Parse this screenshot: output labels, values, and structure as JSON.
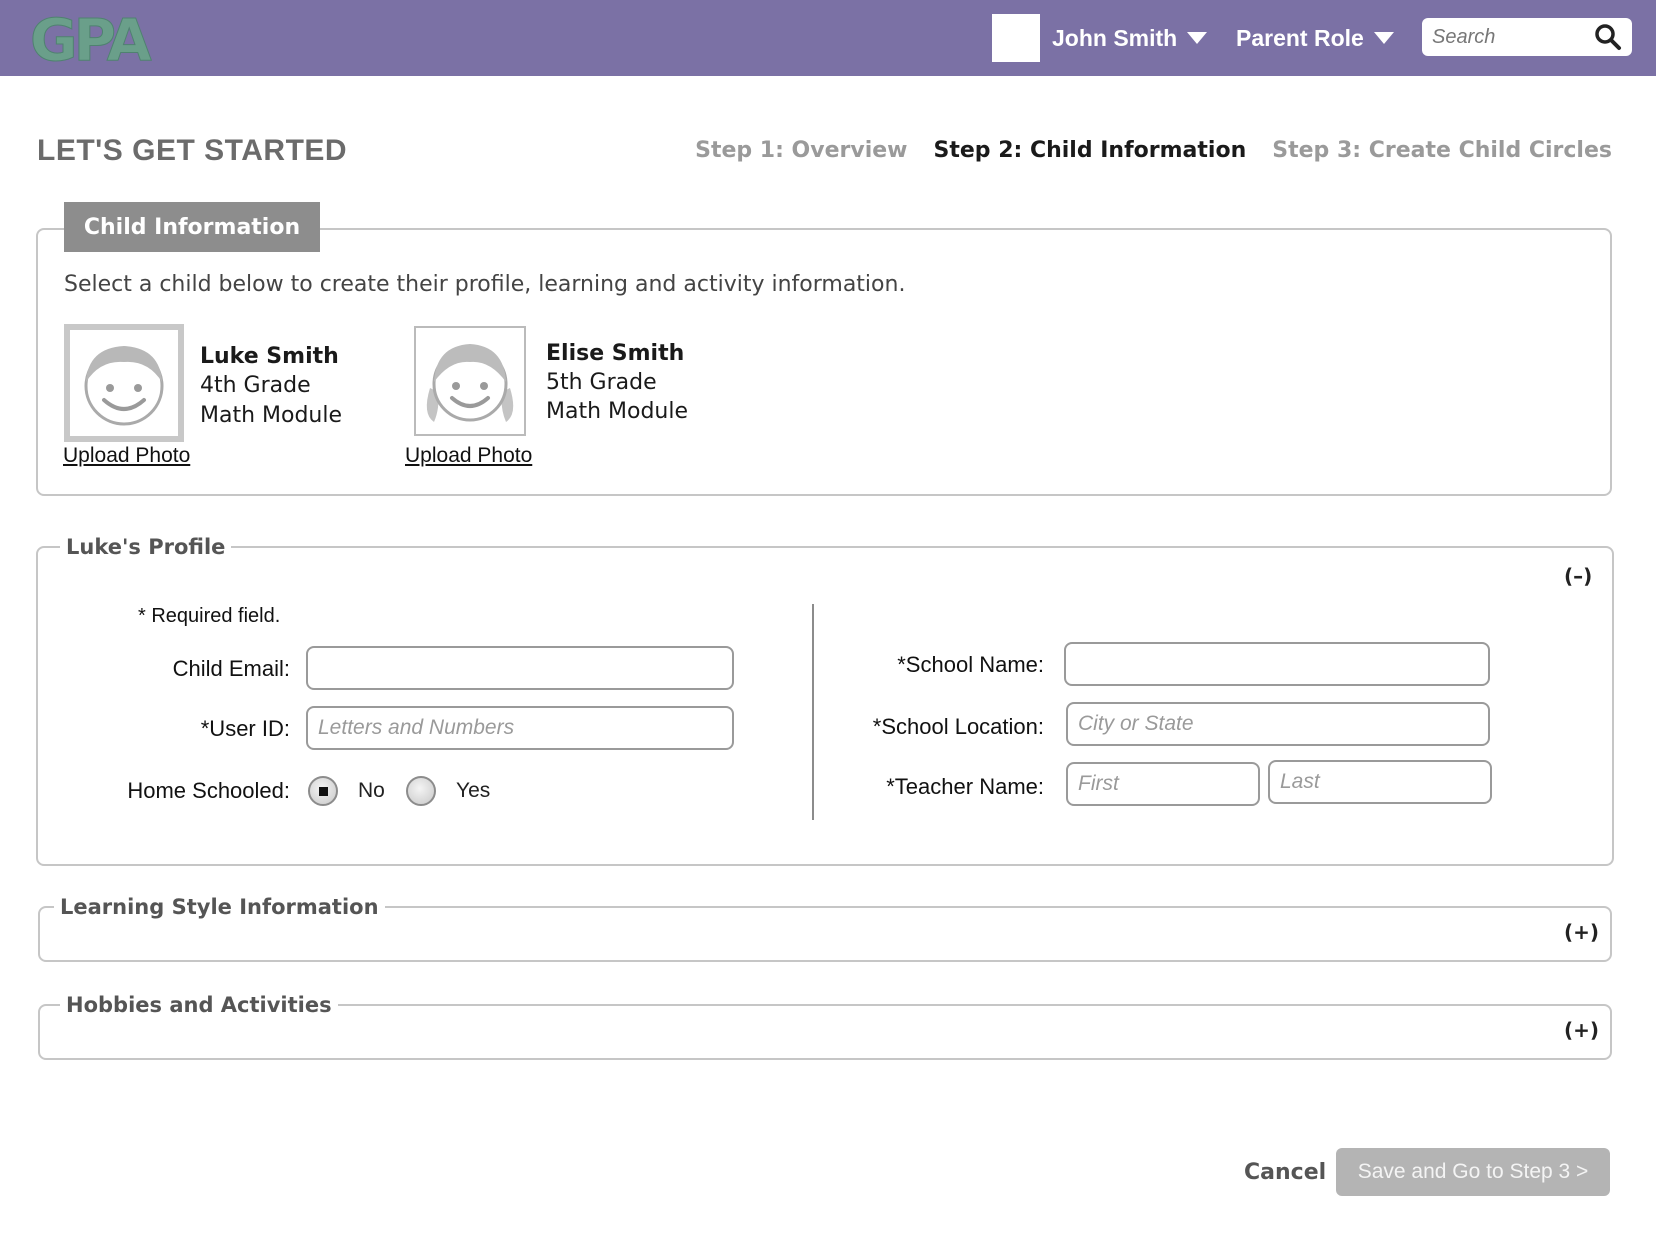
{
  "header": {
    "logo_text": "GPA",
    "user_name": "John Smith",
    "role": "Parent Role",
    "search": {
      "placeholder": "Search"
    }
  },
  "page": {
    "title": "LET'S GET STARTED",
    "steps": [
      {
        "label": "Step 1: Overview",
        "active": false
      },
      {
        "label": "Step 2: Child Information",
        "active": true
      },
      {
        "label": "Step 3: Create Child Circles",
        "active": false
      }
    ]
  },
  "child_info": {
    "tab_label": "Child Information",
    "instructions": "Select a child below to create their profile, learning and activity information.",
    "children": [
      {
        "name": "Luke Smith",
        "grade": "4th Grade",
        "module": "Math Module",
        "upload_label": "Upload Photo",
        "selected": true
      },
      {
        "name": "Elise Smith",
        "grade": "5th Grade",
        "module": "Math Module",
        "upload_label": "Upload Photo",
        "selected": false
      }
    ]
  },
  "profile": {
    "legend": "Luke's Profile",
    "toggle": "(–)",
    "required_note": "* Required field.",
    "child_email": {
      "label": "Child Email:",
      "value": "",
      "placeholder": ""
    },
    "user_id": {
      "label": "*User ID:",
      "value": "",
      "placeholder": "Letters and Numbers"
    },
    "home_schooled": {
      "label": "Home Schooled:",
      "options": [
        {
          "label": "No",
          "selected": true
        },
        {
          "label": "Yes",
          "selected": false
        }
      ]
    },
    "school_name": {
      "label": "*School Name:",
      "value": "",
      "placeholder": ""
    },
    "school_location": {
      "label": "*School Location:",
      "value": "",
      "placeholder": "City or State"
    },
    "teacher_name": {
      "label": "*Teacher Name:",
      "first_placeholder": "First",
      "last_placeholder": "Last"
    }
  },
  "learning_style": {
    "legend": "Learning Style Information",
    "toggle": "(+)"
  },
  "hobbies": {
    "legend": "Hobbies and Activities",
    "toggle": "(+)"
  },
  "footer": {
    "cancel_label": "Cancel",
    "save_label": "Save and Go to Step 3 >"
  },
  "colors": {
    "header_bg": "#7b71a5",
    "logo_green": "#6a9f8a",
    "tab_bg": "#8d8d8d",
    "save_button_bg": "#b4b4b4",
    "active_step": "#1a1a1a",
    "inactive_step": "#9a9a9a"
  }
}
